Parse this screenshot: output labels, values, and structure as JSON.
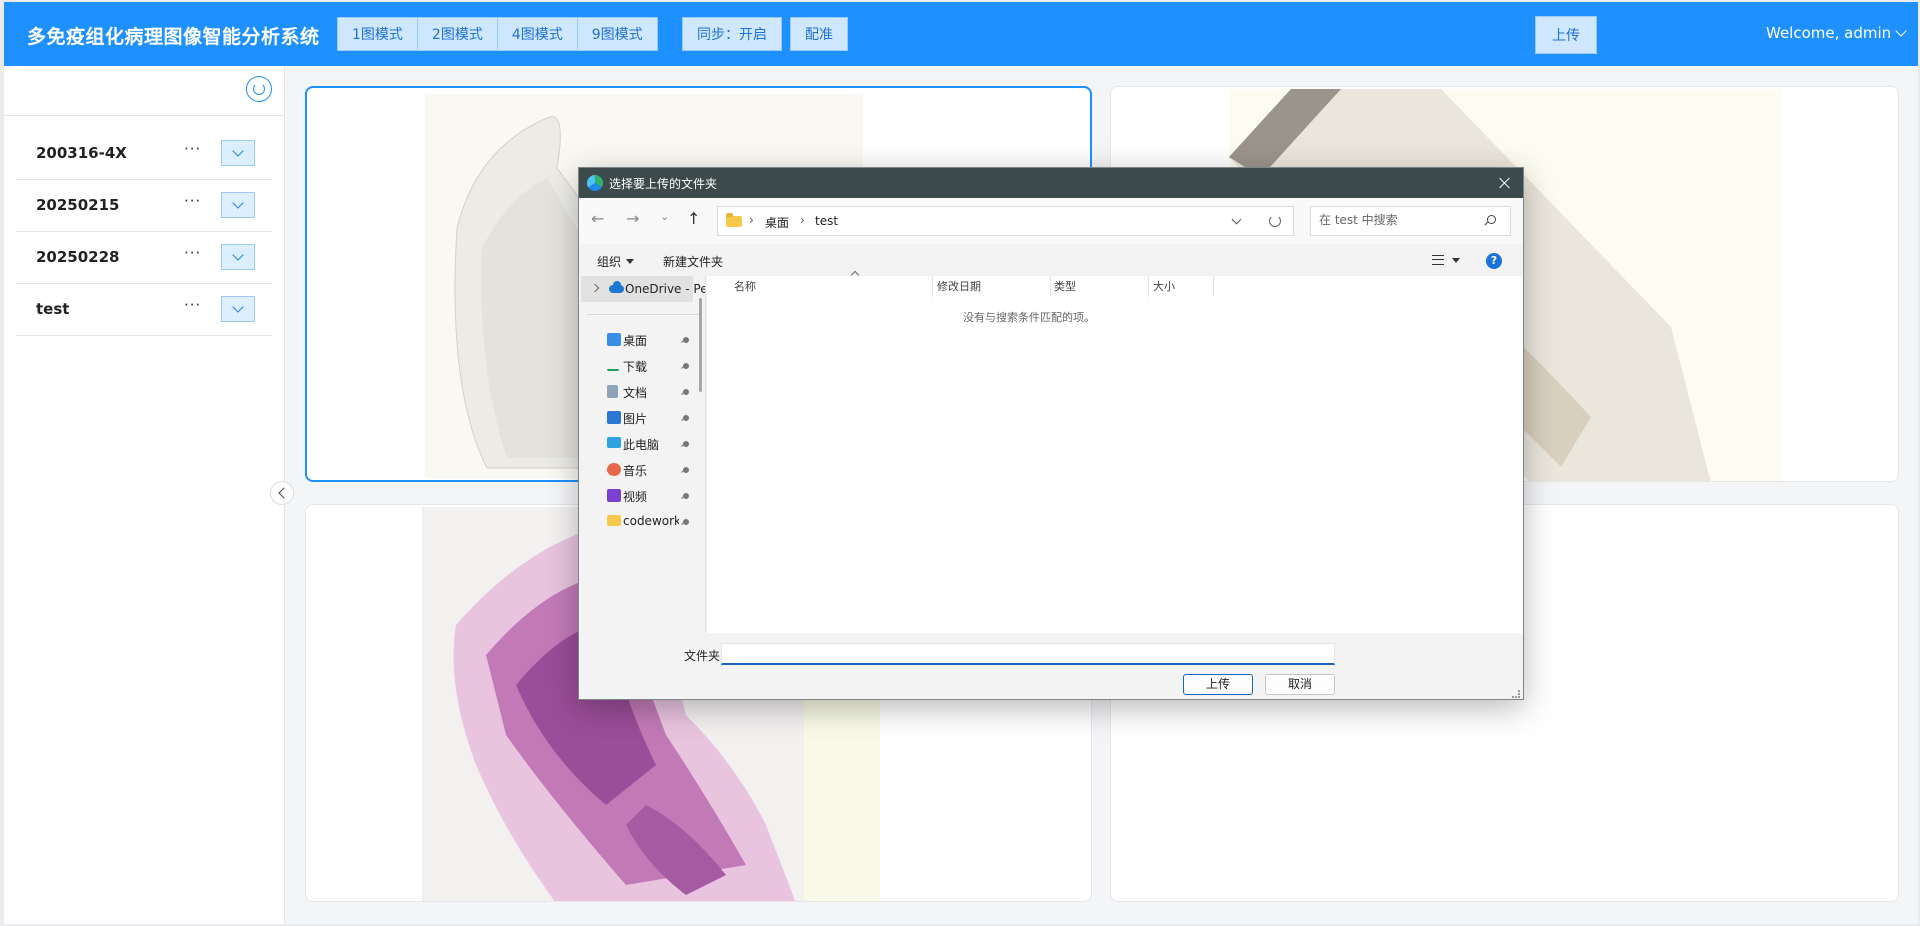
{
  "header": {
    "title": "多免疫组化病理图像智能分析系统",
    "modes": [
      "1图模式",
      "2图模式",
      "4图模式",
      "9图模式"
    ],
    "sync_label": "同步：开启",
    "register_label": "配准",
    "upload_label": "上传",
    "welcome": "Welcome, admin",
    "accent_color": "#1e90ff"
  },
  "sidebar": {
    "items": [
      {
        "name": "200316-4X",
        "more": "···"
      },
      {
        "name": "20250215",
        "more": "···"
      },
      {
        "name": "20250228",
        "more": "···"
      },
      {
        "name": "test",
        "more": "···"
      }
    ]
  },
  "dialog": {
    "title": "选择要上传的文件夹",
    "breadcrumb": [
      "桌面",
      "test"
    ],
    "search_placeholder": "在 test 中搜索",
    "organize_label": "组织",
    "new_folder_label": "新建文件夹",
    "help_glyph": "?",
    "nav": {
      "onedrive_label": "OneDrive - Per",
      "quick_access": [
        {
          "label": "桌面",
          "icon": "desktop-icon"
        },
        {
          "label": "下载",
          "icon": "download-icon"
        },
        {
          "label": "文档",
          "icon": "document-icon"
        },
        {
          "label": "图片",
          "icon": "pictures-icon"
        },
        {
          "label": "此电脑",
          "icon": "computer-icon"
        },
        {
          "label": "音乐",
          "icon": "music-icon"
        },
        {
          "label": "视频",
          "icon": "video-icon"
        },
        {
          "label": "codeworksp",
          "icon": "folder-icon"
        }
      ]
    },
    "columns": [
      "名称",
      "修改日期",
      "类型",
      "大小"
    ],
    "empty_message": "没有与搜索条件匹配的项。",
    "folder_field_label": "文件夹:",
    "folder_field_value": "",
    "ok_label": "上传",
    "cancel_label": "取消"
  }
}
